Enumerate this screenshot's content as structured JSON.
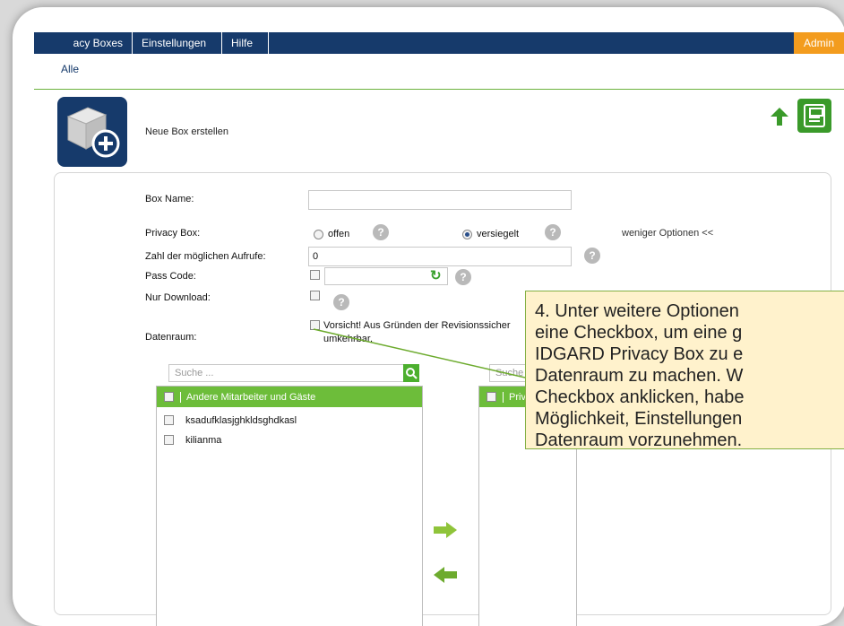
{
  "nav": {
    "items": [
      "acy Boxes",
      "Einstellungen",
      "Hilfe"
    ],
    "admin": "Admin"
  },
  "breadcrumb": "Alle",
  "page": {
    "title": "Neue Box erstellen"
  },
  "form": {
    "box_name_label": "Box Name:",
    "privacy_box_label": "Privacy Box:",
    "radio_open": "offen",
    "radio_sealed": "versiegelt",
    "fewer_options": "weniger Optionen <<",
    "calls_label": "Zahl der möglichen Aufrufe:",
    "calls_value": "0",
    "pass_code_label": "Pass Code:",
    "download_only_label": "Nur Download:",
    "data_room_label": "Datenraum:",
    "data_room_warning_line1": "Vorsicht! Aus Gründen der Revisionssicher",
    "data_room_warning_line2": "umkehrbar."
  },
  "lists": {
    "left": {
      "search_placeholder": "Suche ...",
      "header": "Andere Mitarbeiter und Gäste",
      "rows": [
        "ksadufklasjghkldsghdkasl",
        "kilianma"
      ]
    },
    "right": {
      "search_placeholder": "Suche ...",
      "header": "Privac"
    }
  },
  "tooltip": {
    "text": "4. Unter weitere Optionen\neine Checkbox, um eine g\nIDGARD Privacy Box zu e\nDatenraum zu machen. W\nCheckbox anklicken, habe\nMöglichkeit, Einstellungen\nDatenraum vorzunehmen."
  },
  "colors": {
    "navy": "#163a6b",
    "admin_orange": "#f39c1e",
    "green": "#6dbd3a",
    "tooltip_bg": "#fff2cc"
  }
}
